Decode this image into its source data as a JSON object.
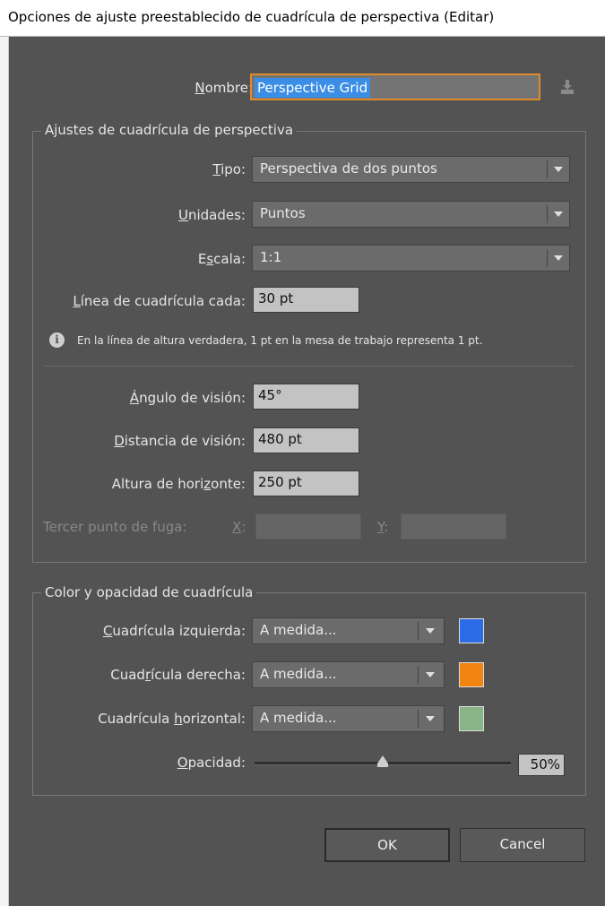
{
  "window": {
    "title": "Opciones de ajuste preestablecido de cuadrícula de perspectiva (Editar)"
  },
  "name_row": {
    "label_pre": "",
    "label_u": "N",
    "label_post": "ombre:",
    "value": "Perspective Grid",
    "save_icon": "download-icon"
  },
  "grid_settings": {
    "legend": "Ajustes de cuadrícula de perspectiva",
    "tipo": {
      "label_pre": "",
      "label_u": "T",
      "label_post": "ipo:",
      "value": "Perspectiva de dos puntos"
    },
    "unidades": {
      "label_pre": "",
      "label_u": "U",
      "label_post": "nidades:",
      "value": "Puntos"
    },
    "escala": {
      "label_pre": "E",
      "label_u": "s",
      "label_post": "cala:",
      "value": "1:1"
    },
    "linea": {
      "label_pre": "",
      "label_u": "L",
      "label_post": "ínea de cuadrícula cada:",
      "value": "30 pt"
    },
    "info_text": "En la línea de altura verdadera, 1 pt en la mesa de trabajo representa 1 pt.",
    "angulo": {
      "label_pre": "",
      "label_u": "Á",
      "label_post": "ngulo de visión:",
      "value": "45°"
    },
    "distancia": {
      "label_pre": "",
      "label_u": "D",
      "label_post": "istancia de visión:",
      "value": "480 pt"
    },
    "altura": {
      "label_pre": "Altura de hori",
      "label_u": "z",
      "label_post": "onte:",
      "value": "250 pt"
    },
    "tercer": {
      "label": "Tercer punto de fuga:",
      "x_label_u": "X",
      "x_label_post": ":",
      "y_label_u": "Y",
      "y_label_post": ":",
      "x_value": "",
      "y_value": ""
    }
  },
  "color_settings": {
    "legend": "Color y opacidad de cuadrícula",
    "izquierda": {
      "label_pre": "",
      "label_u": "C",
      "label_post": "uadrícula izquierda:",
      "value": "A medida...",
      "color": "#2b6be6"
    },
    "derecha": {
      "label_pre": "Cuad",
      "label_u": "r",
      "label_post": "ícula derecha:",
      "value": "A medida...",
      "color": "#f2840f"
    },
    "horizontal": {
      "label_pre": "Cuadrícula ",
      "label_u": "h",
      "label_post": "orizontal:",
      "value": "A medida...",
      "color": "#88b487"
    },
    "opacidad": {
      "label_pre": "",
      "label_u": "O",
      "label_post": "pacidad:",
      "value": "50%",
      "level": 0.5
    }
  },
  "buttons": {
    "ok": "OK",
    "cancel": "Cancel"
  }
}
